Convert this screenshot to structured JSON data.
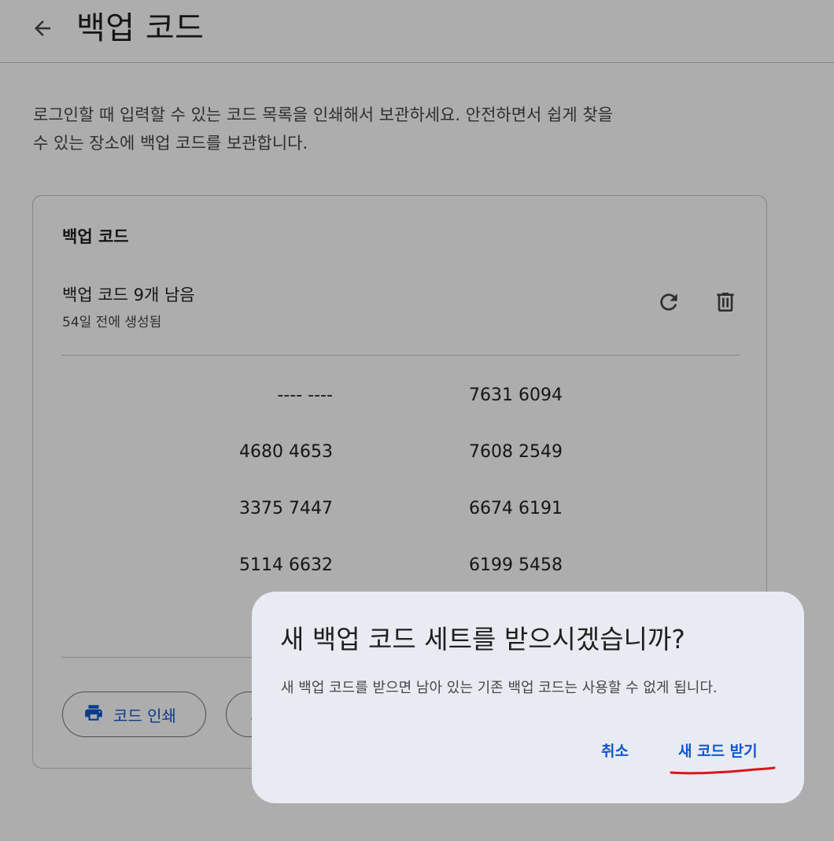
{
  "header": {
    "title": "백업 코드"
  },
  "intro": {
    "line1": "로그인할 때 입력할 수 있는 코드 목록을 인쇄해서 보관하세요. 안전하면서 쉽게 찾을",
    "line2": "수 있는 장소에 백업 코드를 보관합니다."
  },
  "card": {
    "title": "백업 코드",
    "remaining": "백업 코드 9개 남음",
    "created": "54일 전에 생성됨",
    "codes": [
      [
        "---- ----",
        "7631 6094"
      ],
      [
        "4680 4653",
        "7608 2549"
      ],
      [
        "3375 7447",
        "6674 6191"
      ],
      [
        "5114 6632",
        "6199 5458"
      ]
    ],
    "print_label": "코드 인쇄"
  },
  "dialog": {
    "title": "새 백업 코드 세트를 받으시겠습니까?",
    "body": "새 백업 코드를 받으면 남아 있는 기존 백업 코드는 사용할 수 없게 됩니다.",
    "cancel_label": "취소",
    "confirm_label": "새 코드 받기"
  },
  "colors": {
    "accent": "#0b57d0",
    "annotation": "#e0141e",
    "dialog_bg": "#e8ecf2",
    "scrim": "rgba(0,0,0,0.32)"
  },
  "icons": {
    "back": "arrow-back-icon",
    "refresh": "refresh-icon",
    "delete": "trash-icon",
    "print": "printer-icon",
    "download": "download-icon"
  }
}
